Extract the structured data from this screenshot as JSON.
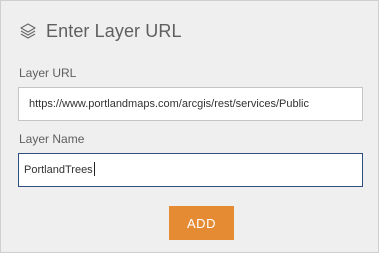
{
  "header": {
    "icon": "layers-icon",
    "title": "Enter Layer URL"
  },
  "form": {
    "url_label": "Layer URL",
    "url_value": "https://www.portlandmaps.com/arcgis/rest/services/Public",
    "name_label": "Layer Name",
    "name_value": "PortlandTrees"
  },
  "actions": {
    "add_label": "ADD"
  },
  "colors": {
    "accent": "#e48b34",
    "focus_border": "#2f4f80",
    "panel_bg": "#efefef"
  }
}
